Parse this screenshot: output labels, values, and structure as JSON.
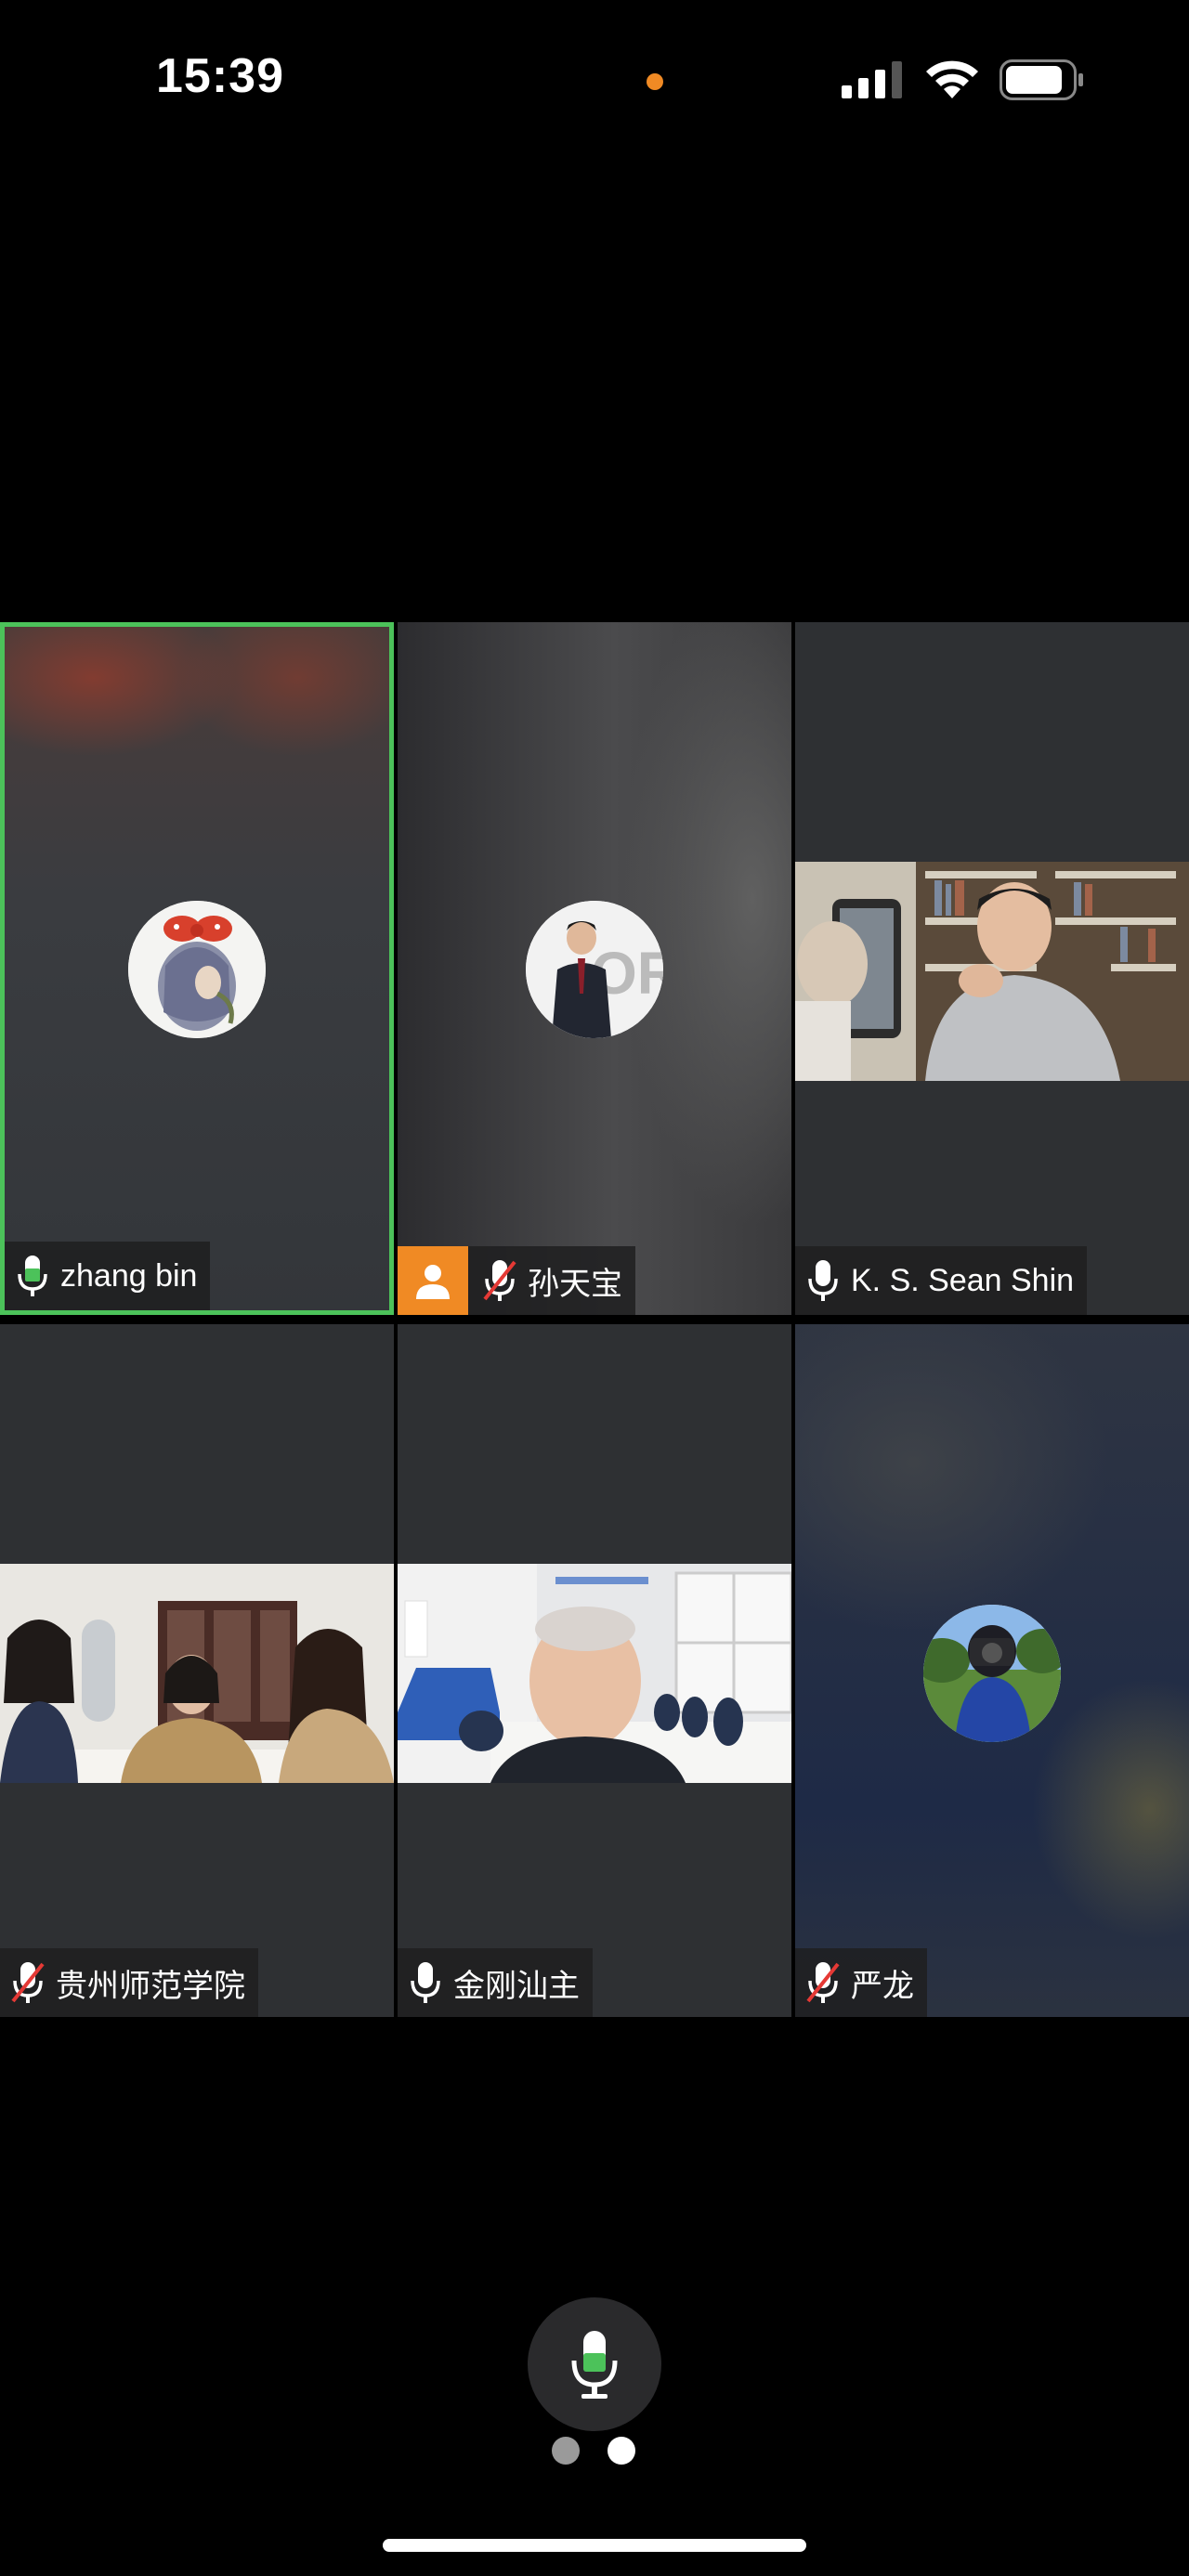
{
  "status_bar": {
    "time": "15:39",
    "privacy_indicator_color": "#f08a24",
    "icons": [
      "cellular-signal-icon",
      "wifi-icon",
      "battery-icon"
    ]
  },
  "meeting": {
    "active_speaker_color": "#4cc25a",
    "participants": [
      {
        "name": "zhang bin",
        "mic": "on",
        "mic_level": "active",
        "tile": "avatar",
        "active_speaker": true
      },
      {
        "name": "孙天宝",
        "mic": "muted",
        "video_off_badge": true,
        "tile": "avatar"
      },
      {
        "name": "K. S. Sean Shin",
        "mic": "on",
        "tile": "video"
      },
      {
        "name": "贵州师范学院",
        "mic": "muted",
        "tile": "video"
      },
      {
        "name": "金刚汕主",
        "mic": "on",
        "tile": "video"
      },
      {
        "name": "严龙",
        "mic": "muted",
        "tile": "avatar"
      }
    ]
  },
  "controls": {
    "mic_button": "microphone-icon",
    "page_count": 2,
    "current_page": 2
  }
}
